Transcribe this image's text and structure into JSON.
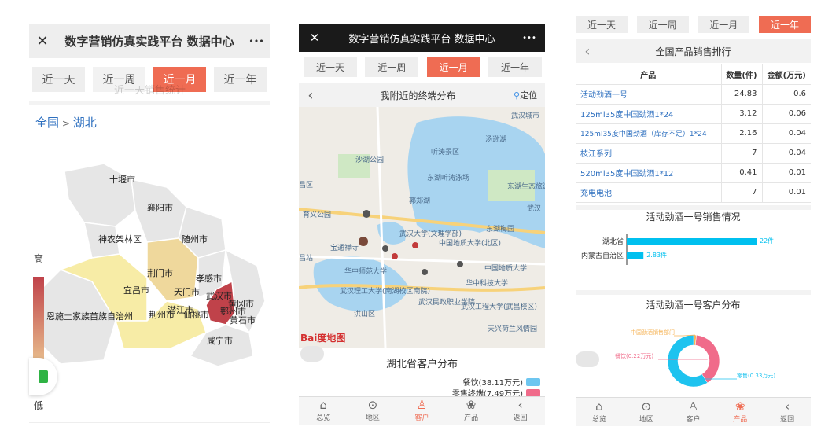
{
  "panel1": {
    "close_glyph": "✕",
    "title": "数字营销仿真实践平台 数据中心",
    "more_glyph": "•••",
    "tabs": [
      "近一天",
      "近一周",
      "近一月",
      "近一年"
    ],
    "active_tab": 2,
    "ghost_title": "近一天销售统计",
    "breadcrumb_root": "全国",
    "breadcrumb_sep": " > ",
    "breadcrumb_current": "湖北",
    "legend_high": "高",
    "legend_low": "低",
    "cities": [
      "十堰市",
      "襄阳市",
      "神农架林区",
      "随州市",
      "荆门市",
      "孝感市",
      "宜昌市",
      "天门市",
      "武汉市",
      "黄冈市",
      "恩施土家族苗族自治州",
      "荆州市",
      "潜江市",
      "仙桃市",
      "鄂州市",
      "黄石市",
      "咸宁市"
    ]
  },
  "panel2": {
    "close_glyph": "✕",
    "title": "数字营销仿真实践平台 数据中心",
    "more_glyph": "•••",
    "tabs": [
      "近一天",
      "近一周",
      "近一月",
      "近一年"
    ],
    "active_tab": 2,
    "header": "我附近的终端分布",
    "locate": "定位",
    "map_labels": [
      "武汉城市",
      "汤逊湖",
      "听涛景区",
      "沙湖公园",
      "东湖听涛泳场",
      "东湖生态旅游风景区",
      "郭郑湖",
      "武汉",
      "育义公园",
      "宝通禅寺",
      "东湖梅园",
      "武汉大学(文理学部)",
      "中国地质大学(北区)",
      "中国地质大学",
      "昌站",
      "华中师范大学",
      "华中科技大学",
      "武汉理工大学(南湖校区南院)",
      "武汉民政职业学院",
      "武汉工程大学(武昌校区)",
      "洪山区",
      "天兴荷兰风情园",
      "昌区"
    ],
    "baidu_logo": "Bai度地图",
    "chart_title": "湖北省客户分布",
    "legend": [
      {
        "label": "餐饮(38.11万元)",
        "color": "#6ec6f0"
      },
      {
        "label": "零售终端(7.49万元)",
        "color": "#f06b8a"
      }
    ],
    "nav": [
      "总览",
      "地区",
      "客户",
      "产品",
      "返回"
    ],
    "nav_active": 2
  },
  "panel3": {
    "tabs": [
      "近一天",
      "近一周",
      "近一月",
      "近一年"
    ],
    "active_tab": 3,
    "header": "全国产品销售排行",
    "table_headers": [
      "产品",
      "数量(件)",
      "金额(万元)"
    ],
    "rows": [
      [
        "活动劲酒一号",
        "24.83",
        "0.6"
      ],
      [
        "125ml35度中国劲酒1*24",
        "3.12",
        "0.06"
      ],
      [
        "125ml35度中国劲酒（库存不足）1*24",
        "2.16",
        "0.04"
      ],
      [
        "枝江系列",
        "7",
        "0.04"
      ],
      [
        "520ml35度中国劲酒1*12",
        "0.41",
        "0.01"
      ],
      [
        "充电电池",
        "7",
        "0.01"
      ]
    ],
    "sales_title": "活动劲酒一号销售情况",
    "customer_title": "活动劲酒一号客户分布",
    "pie_labels": [
      "中国劲酒销售部门",
      "餐饮(0.22万元)",
      "零售(0.33万元)"
    ],
    "nav": [
      "总览",
      "地区",
      "客户",
      "产品",
      "返回"
    ],
    "nav_active": 3
  },
  "chart_data": [
    {
      "type": "bar",
      "title": "活动劲酒一号销售情况",
      "categories": [
        "湖北省",
        "内蒙古自治区"
      ],
      "values": [
        22,
        2.83
      ],
      "data_labels": [
        "22件",
        "2.83件"
      ],
      "color": "#00c0ef"
    },
    {
      "type": "pie",
      "title": "活动劲酒一号客户分布",
      "categories": [
        "中国劲酒销售部门",
        "餐饮(0.22万元)",
        "零售(0.33万元)"
      ],
      "values": [
        0.01,
        0.22,
        0.33
      ],
      "colors": [
        "#f6b55a",
        "#f06b8a",
        "#1ec3ef"
      ]
    }
  ]
}
